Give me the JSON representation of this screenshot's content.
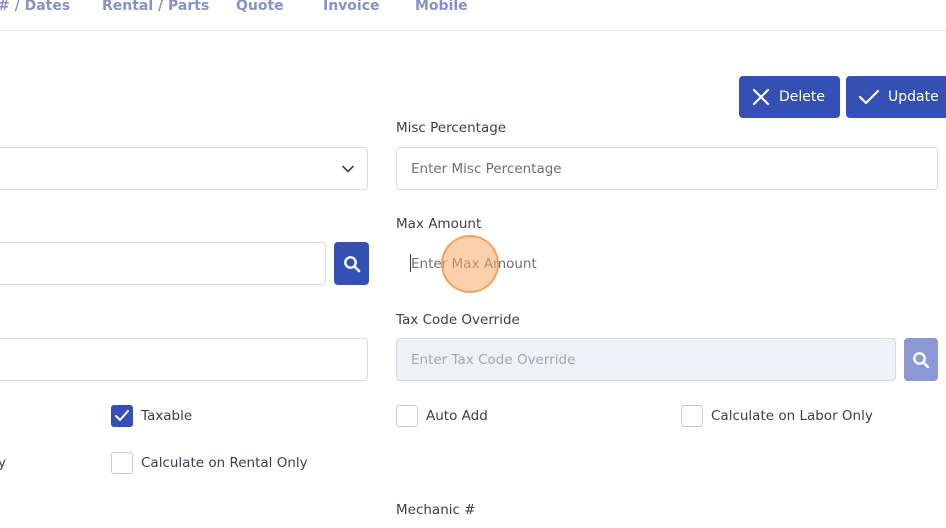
{
  "tabs": [
    "# / Dates",
    "Rental / Parts",
    "Quote",
    "Invoice",
    "Mobile"
  ],
  "actions": {
    "delete_label": "Delete",
    "update_label": "Update"
  },
  "form": {
    "misc_percentage": {
      "label": "Misc Percentage",
      "placeholder": "Enter Misc Percentage"
    },
    "max_amount": {
      "label": "Max Amount",
      "placeholder": "Enter Max Amount"
    },
    "tax_code_override": {
      "label": "Tax Code Override",
      "placeholder": "Enter Tax Code Override"
    },
    "mechanic": {
      "label": "Mechanic #"
    }
  },
  "checkboxes": {
    "taxable": {
      "label": "Taxable",
      "checked": true
    },
    "auto_add": {
      "label": "Auto Add",
      "checked": false
    },
    "calc_labor_only": {
      "label": "Calculate on Labor Only",
      "checked": false
    },
    "calc_rental_only": {
      "label": "Calculate on Rental Only",
      "checked": false
    },
    "left_cut_text": "y"
  },
  "colors": {
    "primary": "#3450b4",
    "primary_light": "#8b98d6",
    "tab_text": "#8492c8",
    "disabled_bg": "#eef2f6"
  },
  "icons": {
    "delete": "close-icon",
    "update": "check-icon",
    "search": "search-icon",
    "select": "chevron-down-icon"
  }
}
